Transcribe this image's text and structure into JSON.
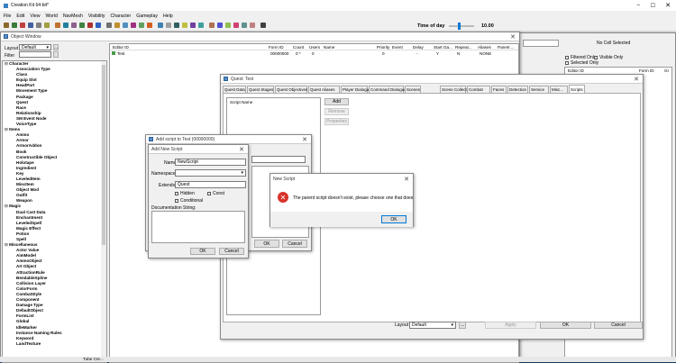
{
  "app": {
    "title": "Creation Kit 64-bit*"
  },
  "menubar": [
    "File",
    "Edit",
    "View",
    "World",
    "NavMesh",
    "Visibility",
    "Character",
    "Gameplay",
    "Help"
  ],
  "toolbar": {
    "time_label": "Time of day",
    "time_value": "10.00"
  },
  "object_window": {
    "title": "Object Window",
    "layout_label": "Layout",
    "layout_value": "Default",
    "filter_label": "Filter",
    "tree": [
      {
        "type": "cat",
        "text": "Character"
      },
      {
        "type": "ch",
        "text": "Association Type"
      },
      {
        "type": "ch",
        "text": "Class"
      },
      {
        "type": "ch",
        "text": "Equip Slot"
      },
      {
        "type": "ch",
        "text": "HeadPart"
      },
      {
        "type": "ch",
        "text": "Movement Type"
      },
      {
        "type": "ch",
        "text": "Package"
      },
      {
        "type": "ch",
        "text": "Quest"
      },
      {
        "type": "ch",
        "text": "Race"
      },
      {
        "type": "ch",
        "text": "Relationship"
      },
      {
        "type": "ch",
        "text": "SM Event Node"
      },
      {
        "type": "ch",
        "text": "VoiceType"
      },
      {
        "type": "cat",
        "text": "Items"
      },
      {
        "type": "ch",
        "text": "Ammo"
      },
      {
        "type": "ch",
        "text": "Armor"
      },
      {
        "type": "ch",
        "text": "ArmorAddon"
      },
      {
        "type": "ch",
        "text": "Book"
      },
      {
        "type": "ch",
        "text": "Constructible Object"
      },
      {
        "type": "ch",
        "text": "Holotape"
      },
      {
        "type": "ch",
        "text": "Ingredient"
      },
      {
        "type": "ch",
        "text": "Key"
      },
      {
        "type": "ch",
        "text": "LeveledItem"
      },
      {
        "type": "ch",
        "text": "MiscItem"
      },
      {
        "type": "ch",
        "text": "Object Mod"
      },
      {
        "type": "ch",
        "text": "Outfit"
      },
      {
        "type": "ch",
        "text": "Weapon"
      },
      {
        "type": "cat",
        "text": "Magic"
      },
      {
        "type": "ch",
        "text": "Dual Cast Data"
      },
      {
        "type": "ch",
        "text": "Enchantment"
      },
      {
        "type": "ch",
        "text": "LeveledSpell"
      },
      {
        "type": "ch",
        "text": "Magic Effect"
      },
      {
        "type": "ch",
        "text": "Potion"
      },
      {
        "type": "ch",
        "text": "Spell"
      },
      {
        "type": "cat",
        "text": "Miscellaneous"
      },
      {
        "type": "ch",
        "text": "Actor Value"
      },
      {
        "type": "ch",
        "text": "AimModel"
      },
      {
        "type": "ch",
        "text": "AmmoObject"
      },
      {
        "type": "ch",
        "text": "Art Object"
      },
      {
        "type": "ch",
        "text": "AttractionRule"
      },
      {
        "type": "ch",
        "text": "BendableSpline"
      },
      {
        "type": "ch",
        "text": "Collision Layer"
      },
      {
        "type": "ch",
        "text": "ColorForm"
      },
      {
        "type": "ch",
        "text": "CombatStyle"
      },
      {
        "type": "ch",
        "text": "Component"
      },
      {
        "type": "ch",
        "text": "Damage Type"
      },
      {
        "type": "ch",
        "text": "DefaultObject"
      },
      {
        "type": "ch",
        "text": "FormList"
      },
      {
        "type": "ch",
        "text": "Global"
      },
      {
        "type": "ch",
        "text": "IdleMarker"
      },
      {
        "type": "ch",
        "text": "Instance Naming Rules"
      },
      {
        "type": "ch",
        "text": "Keyword"
      },
      {
        "type": "ch",
        "text": "LandTexture"
      }
    ],
    "columns": [
      "Editor ID",
      "Form ID",
      "Count",
      "Users",
      "Name",
      "Priority",
      "Event",
      "Delay",
      "Start Ga...",
      "Repeat...",
      "Aliases",
      "Parent ..."
    ],
    "row": {
      "editor_id": "Test",
      "form_id": "00000000",
      "count": "0 *",
      "users": "0",
      "priority": "0",
      "delay": "-",
      "start": "Y",
      "repeat": "N",
      "aliases": "NONE"
    }
  },
  "right_window": {
    "cell_label": "No Cell Selected",
    "filtered_only": "Filtered Only",
    "visible_only": "Visible Only",
    "selected_only": "Selected Only",
    "col1": "Editor ID",
    "col2": "Form ID",
    "col3": "Gr"
  },
  "status": {
    "text": "Tube Cre..."
  },
  "quest_window": {
    "title": "Quest: Test",
    "tabs": [
      "Quest Data",
      "Quest Stages",
      "Quest Objectives",
      "Quest Aliases",
      "Player Dialogue",
      "Command Dialogue",
      "Scenes",
      "Scene Collections",
      "Combat",
      "Faces",
      "Detection",
      "Service",
      "Misc...",
      "Scripts"
    ],
    "script_col": "Script Name",
    "add": "Add",
    "remove": "Remove",
    "properties": "Properties",
    "layout_label": "Layout",
    "layout_value": "Default",
    "apply": "Apply",
    "ok": "OK",
    "cancel": "Cancel"
  },
  "add_script_window": {
    "title": "Add script to Test (00000000)",
    "ok": "OK",
    "cancel": "Cancel"
  },
  "new_script_dialog": {
    "title": "Add New Script",
    "name_label": "Name:",
    "name_value": "NewScript",
    "namespace_label": "Namespace:",
    "extends_label": "Extends:",
    "extends_value": "Quest",
    "hidden": "Hidden",
    "const": "Const",
    "conditional": "Conditional",
    "doc_label": "Documentation String:",
    "ok": "OK",
    "cancel": "Cancel"
  },
  "error_dialog": {
    "title": "New Script",
    "message": "The parent script doesn't exist, please choose one that does",
    "ok": "OK"
  }
}
